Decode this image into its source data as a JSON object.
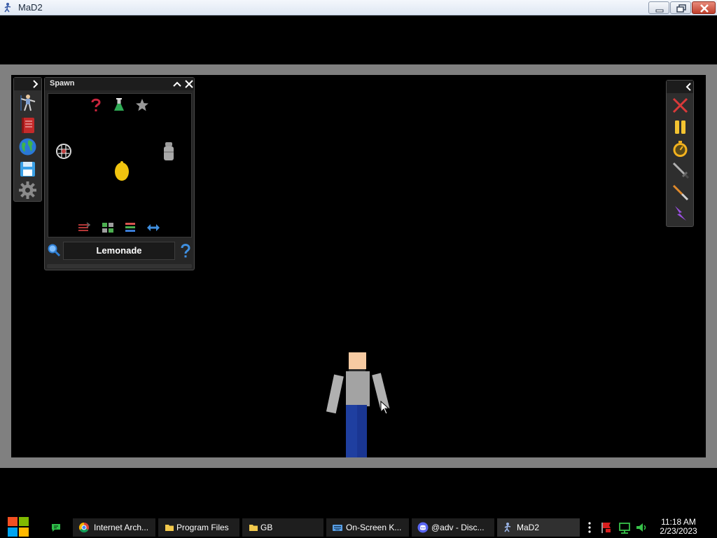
{
  "window": {
    "title": "MaD2",
    "icon": "mad2-app-icon",
    "controls": [
      "minimize-icon",
      "restore-icon",
      "close-icon"
    ]
  },
  "left_toolbar": {
    "toggle_icon": "chevron-right-icon",
    "tools": [
      {
        "name": "ragdoll-pose-tool",
        "icon": "ragdoll-icon"
      },
      {
        "name": "catalog-book",
        "icon": "book-icon"
      },
      {
        "name": "world",
        "icon": "globe-icon"
      },
      {
        "name": "save",
        "icon": "floppy-disk-icon"
      },
      {
        "name": "settings",
        "icon": "gear-icon"
      }
    ]
  },
  "spawn_panel": {
    "title": "Spawn",
    "header_icons": [
      "collapse-icon",
      "close-icon"
    ],
    "category_icons": [
      "random-question-icon",
      "flask-icon",
      "star-icon"
    ],
    "items": [
      {
        "name": "mesh-ball",
        "icon": "wire-ball-icon"
      },
      {
        "name": "lemon",
        "icon": "lemon-icon"
      },
      {
        "name": "canister",
        "icon": "canister-icon"
      }
    ],
    "bottom_icons": [
      "sort-icon",
      "grid-view-icon",
      "list-view-icon",
      "swap-arrows-icon"
    ],
    "search_icon": "magnifier-icon",
    "search_value": "Lemonade",
    "help_icon": "help-question-icon"
  },
  "right_toolbar": {
    "toggle_icon": "chevron-left-icon",
    "tools": [
      {
        "name": "clear-all",
        "icon": "red-x-icon",
        "color": "#d93a3a"
      },
      {
        "name": "pause",
        "icon": "pause-icon",
        "color": "#f3c331"
      },
      {
        "name": "slow-motion",
        "icon": "stopwatch-icon",
        "color": "#f3b21e"
      },
      {
        "name": "sword-tool",
        "icon": "sword-icon"
      },
      {
        "name": "knife-tool",
        "icon": "knife-icon"
      },
      {
        "name": "lightning-tool",
        "icon": "lightning-icon",
        "color": "#9a4fe0"
      }
    ]
  },
  "taskbar": {
    "start_icon": "windows-logo-icon",
    "pinned": [
      {
        "name": "chat-app",
        "icon": "green-chat-icon"
      }
    ],
    "tasks": [
      {
        "label": "Internet Arch...",
        "icon": "chrome-icon"
      },
      {
        "label": "Program Files",
        "icon": "folder-icon"
      },
      {
        "label": "GB",
        "icon": "folder-icon"
      },
      {
        "label": "On-Screen K...",
        "icon": "keyboard-icon"
      },
      {
        "label": "@adv - Disc...",
        "icon": "discord-icon"
      },
      {
        "label": "MaD2",
        "icon": "mad2-app-icon",
        "active": true
      }
    ],
    "tray_icons": [
      "overflow-dots-icon",
      "flag-icon",
      "network-icon",
      "volume-icon"
    ],
    "clock": {
      "time": "11:18 AM",
      "date": "2/23/2023"
    }
  }
}
